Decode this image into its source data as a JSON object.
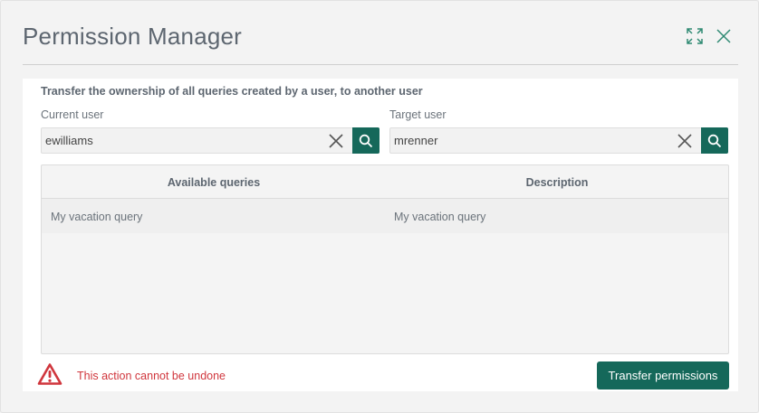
{
  "dialog": {
    "title": "Permission Manager",
    "icons": {
      "expand": "expand-icon",
      "close": "close-icon"
    }
  },
  "form": {
    "subtitle": "Transfer the ownership of all queries created by a user, to another user",
    "current_user": {
      "label": "Current user",
      "value": "ewilliams"
    },
    "target_user": {
      "label": "Target user",
      "value": "mrenner"
    }
  },
  "table": {
    "headers": [
      "Available queries",
      "Description"
    ],
    "rows": [
      {
        "query": "My vacation query",
        "description": "My vacation query"
      }
    ]
  },
  "footer": {
    "warning": "This action cannot be undone",
    "transfer_label": "Transfer permissions"
  },
  "colors": {
    "accent": "#15685a",
    "warning": "#d0363d",
    "title": "#5d6670"
  }
}
